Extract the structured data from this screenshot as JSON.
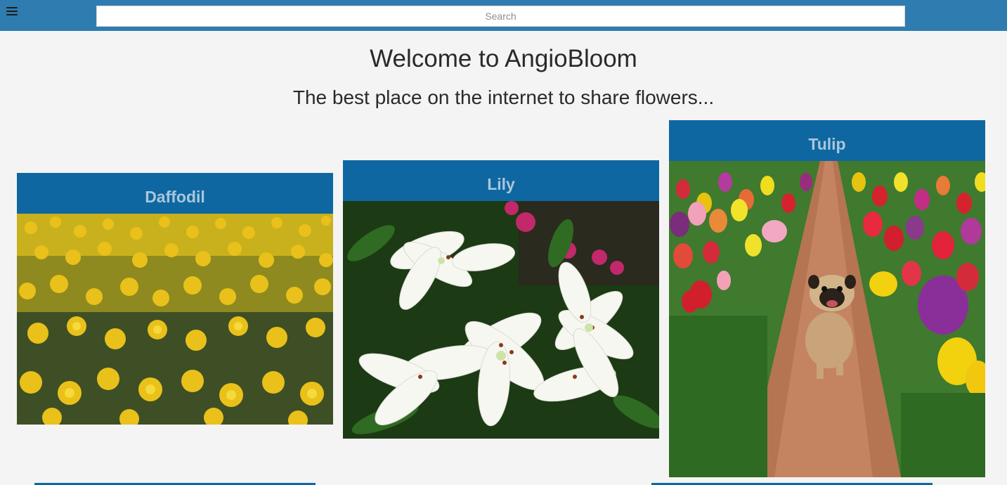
{
  "header": {
    "menu_icon": "hamburger-menu-icon",
    "search": {
      "placeholder": "Search",
      "value": ""
    },
    "bar_color": "#2f7cb0"
  },
  "main": {
    "title": "Welcome to AngioBloom",
    "subtitle": "The best place on the internet to share flowers..."
  },
  "cards": [
    {
      "label": "Daffodil",
      "image": "daffodil-field-photo"
    },
    {
      "label": "Lily",
      "image": "white-lilies-photo"
    },
    {
      "label": "Tulip",
      "image": "tulip-field-pug-photo"
    }
  ],
  "colors": {
    "card_header": "#0e67a0",
    "card_label": "#a9c6dc",
    "background": "#f4f4f4"
  }
}
